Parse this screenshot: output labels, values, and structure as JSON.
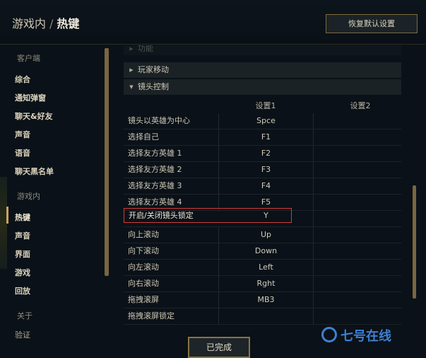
{
  "header": {
    "crumb": "游戏内",
    "separator": "/",
    "current": "热键",
    "restore_label": "恢复默认设置"
  },
  "sidebar": {
    "sections": [
      {
        "label": "客户端",
        "items": [
          "综合",
          "通知弹窗",
          "聊天&好友",
          "声音",
          "语音",
          "聊天黑名单"
        ]
      },
      {
        "label": "游戏内",
        "items": [
          "热键",
          "声音",
          "界面",
          "游戏",
          "回放"
        ]
      },
      {
        "label": "关于",
        "items": [
          "验证"
        ]
      }
    ],
    "active": "热键"
  },
  "panel": {
    "top_group": "功能",
    "groups": [
      "玩家移动",
      "镜头控制"
    ],
    "col1": "设置1",
    "col2": "设置2",
    "rows": [
      {
        "label": "镜头以英雄为中心",
        "key1": "Spce",
        "key2": ""
      },
      {
        "label": "选择自己",
        "key1": "F1",
        "key2": ""
      },
      {
        "label": "选择友方英雄 1",
        "key1": "F2",
        "key2": ""
      },
      {
        "label": "选择友方英雄 2",
        "key1": "F3",
        "key2": ""
      },
      {
        "label": "选择友方英雄 3",
        "key1": "F4",
        "key2": ""
      },
      {
        "label": "选择友方英雄 4",
        "key1": "F5",
        "key2": ""
      },
      {
        "label": "开启/关闭镜头锁定",
        "key1": "Y",
        "key2": ""
      },
      {
        "label": "向上滚动",
        "key1": "Up",
        "key2": ""
      },
      {
        "label": "向下滚动",
        "key1": "Down",
        "key2": ""
      },
      {
        "label": "向左滚动",
        "key1": "Left",
        "key2": ""
      },
      {
        "label": "向右滚动",
        "key1": "Rght",
        "key2": ""
      },
      {
        "label": "拖拽滚屏",
        "key1": "MB3",
        "key2": ""
      },
      {
        "label": "拖拽滚屏锁定",
        "key1": "",
        "key2": ""
      }
    ]
  },
  "footer": {
    "done_label": "已完成"
  },
  "watermark": {
    "text": "七号在线"
  },
  "colors": {
    "accent_gold": "#c9a45b",
    "highlight_red": "#d23a3a",
    "background": "#0a1118"
  }
}
